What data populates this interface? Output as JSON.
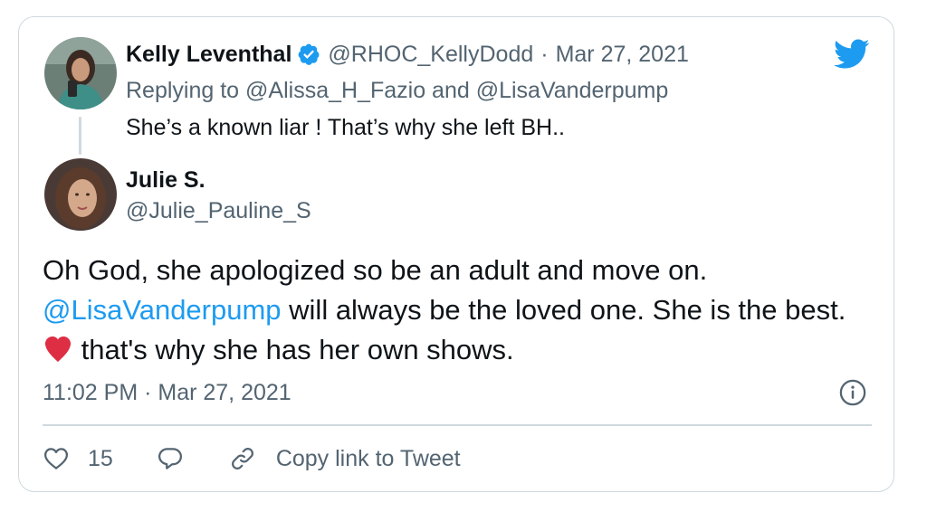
{
  "parent_tweet": {
    "author_name": "Kelly Leventhal",
    "handle": "@RHOC_KellyDodd",
    "separator": "·",
    "date": "Mar 27, 2021",
    "replying_prefix": "Replying to",
    "replying_user_1": "@Alissa_H_Fazio",
    "replying_and": "and",
    "replying_user_2": "@LisaVanderpump",
    "text": "She’s a known liar ! That’s why she left BH.."
  },
  "main_tweet": {
    "author_name": "Julie S.",
    "handle": "@Julie_Pauline_S",
    "text_line1": "Oh God, she apologized so be an adult and move on.",
    "mention": "@LisaVanderpump",
    "text_after_mention": " will always be the loved one. She is the best. ",
    "text_after_emoji": " that's why she has her own shows.",
    "timestamp": "11:02 PM · Mar 27, 2021"
  },
  "actions": {
    "like_count": "15",
    "copy_link_label": "Copy link to Tweet"
  },
  "icons": {
    "logo": "twitter-bird-icon",
    "verified": "verified-badge-icon",
    "emoji": "red-heart-emoji",
    "info": "info-icon",
    "like": "heart-icon",
    "reply": "reply-bubble-icon",
    "link": "link-icon"
  },
  "colors": {
    "brand_blue": "#1d9bf0",
    "text": "#0f1419",
    "muted": "#536471",
    "border": "#cfd9de",
    "heart_red": "#dd2e44"
  }
}
